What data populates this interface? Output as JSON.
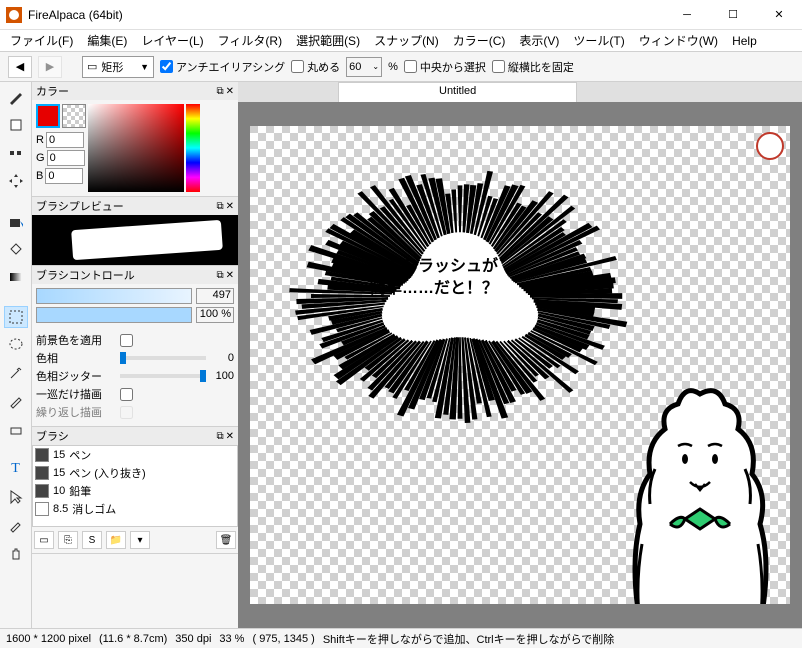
{
  "window": {
    "title": "FireAlpaca (64bit)"
  },
  "menus": [
    "ファイル(F)",
    "編集(E)",
    "レイヤー(L)",
    "フィルタ(R)",
    "選択範囲(S)",
    "スナップ(N)",
    "カラー(C)",
    "表示(V)",
    "ツール(T)",
    "ウィンドウ(W)",
    "Help"
  ],
  "toolbar": {
    "shape": "矩形",
    "antialias_label": "アンチエイリアシング",
    "round_label": "丸める",
    "round_value": "60",
    "percent": "%",
    "from_center_label": "中央から選択",
    "fixed_ratio_label": "縦横比を固定"
  },
  "panels": {
    "color": {
      "title": "カラー",
      "r_label": "R",
      "r_value": "0",
      "g_label": "G",
      "g_value": "0",
      "b_label": "B",
      "b_value": "0"
    },
    "brush_preview": {
      "title": "ブラシプレビュー"
    },
    "brush_control": {
      "title": "ブラシコントロール",
      "size_value": "497",
      "opacity_value": "100 %",
      "fg_label": "前景色を適用",
      "hue_label": "色相",
      "hue_value": "0",
      "hue_jitter_label": "色相ジッター",
      "hue_jitter_value": "100",
      "once_label": "一巡だけ描画",
      "repeat_label": "繰り返し描画"
    },
    "brush": {
      "title": "ブラシ",
      "items": [
        {
          "size": "15",
          "name": "ペン",
          "color": "#444"
        },
        {
          "size": "15",
          "name": "ペン (入り抜き)",
          "color": "#444"
        },
        {
          "size": "10",
          "name": "鉛筆",
          "color": "#444"
        },
        {
          "size": "8.5",
          "name": "消しゴム",
          "color": "#fff"
        }
      ]
    }
  },
  "document": {
    "tab": "Untitled",
    "speech_line1": "ウニフラッシュが",
    "speech_line2": "簡単……だと！？"
  },
  "status": {
    "dimensions": "1600 * 1200 pixel",
    "physical": "(11.6 * 8.7cm)",
    "dpi": "350 dpi",
    "zoom": "33 %",
    "coords": "( 975, 1345 )",
    "hint": "Shiftキーを押しながらで追加、Ctrlキーを押しながらで削除"
  }
}
